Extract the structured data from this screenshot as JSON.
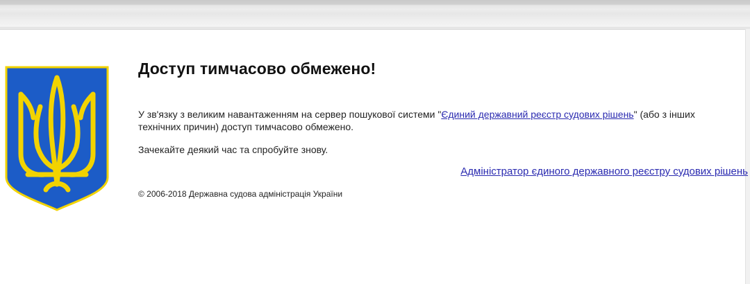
{
  "page": {
    "title": "Доступ тимчасово обмежено!",
    "message_before_link": "У зв'язку з великим навантаженням на сервер пошукової системи \"",
    "registry_link": "Єдиний державний реєстр судових рішень",
    "message_after_link": "\" (або з інших технічних причин) доступ тимчасово обмежено.",
    "retry_text": "Зачекайте деякий час та спробуйте знову.",
    "admin_link": "Адміністратор єдиного державного реєстру судових рішень",
    "footer": "© 2006-2018 Державна судова адміністрація України"
  },
  "colors": {
    "emblem_blue": "#1c5cc7",
    "emblem_gold": "#f2d300",
    "link": "#2a2ab0"
  },
  "icons": {
    "emblem": "coat-of-arms-of-ukraine-icon"
  }
}
